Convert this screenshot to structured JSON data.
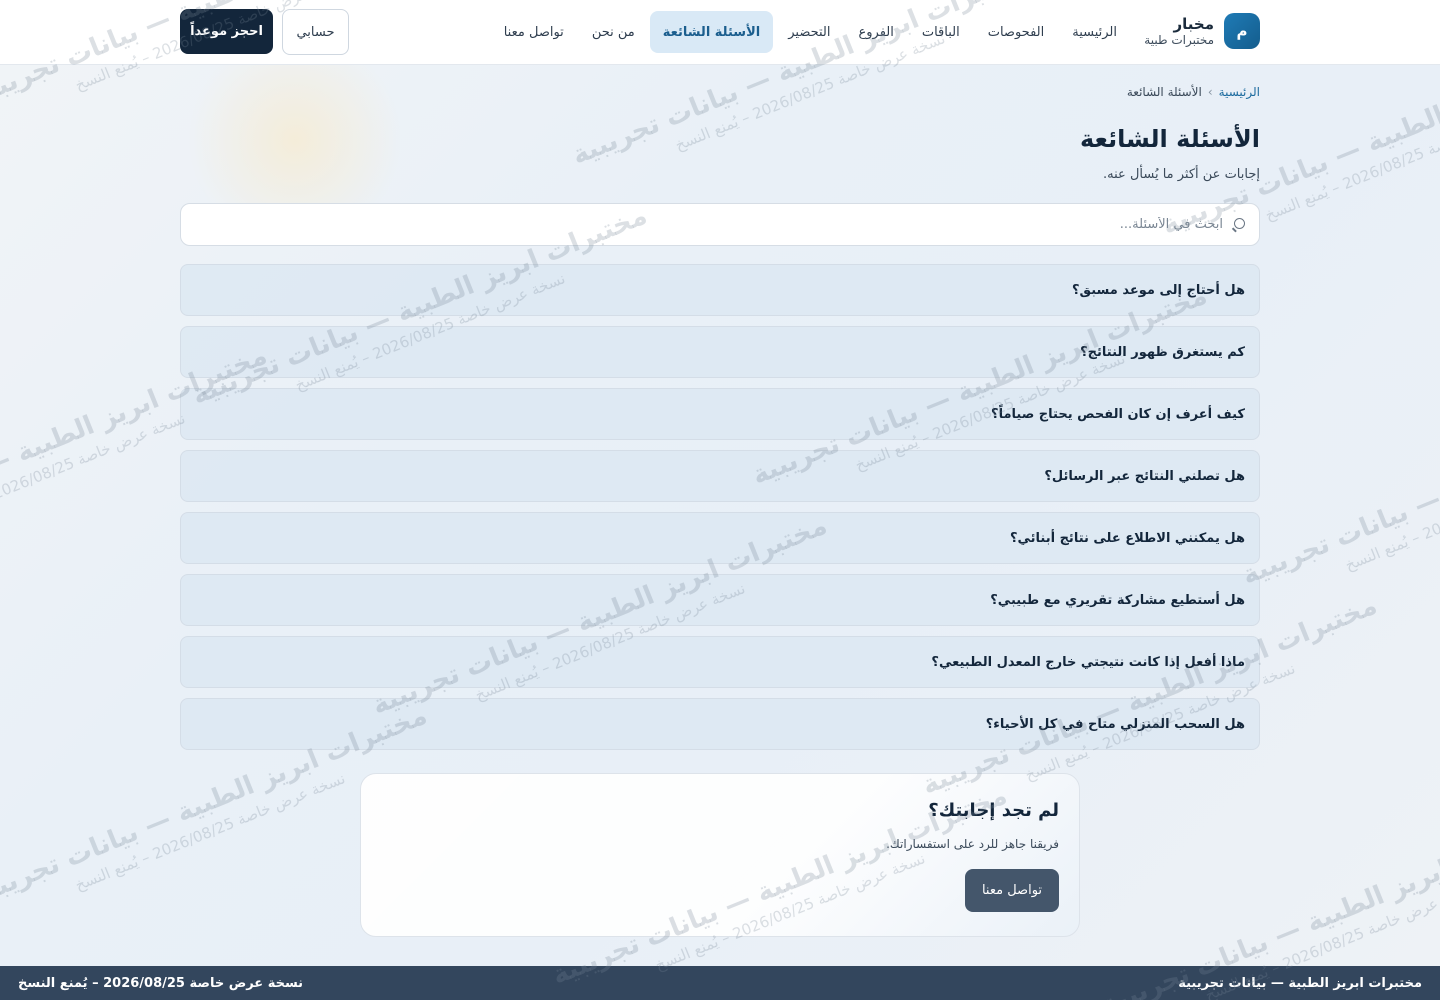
{
  "header": {
    "logo_letter": "م",
    "brand_name": "مخبار",
    "brand_sub": "مختبرات طبية",
    "nav": [
      {
        "label": "الرئيسية"
      },
      {
        "label": "الفحوصات"
      },
      {
        "label": "الباقات"
      },
      {
        "label": "الفروع"
      },
      {
        "label": "التحضير"
      },
      {
        "label": "الأسئلة الشائعة",
        "active": true
      },
      {
        "label": "من نحن"
      },
      {
        "label": "تواصل معنا"
      }
    ],
    "account_label": "حسابي",
    "book_label": "احجز موعداً"
  },
  "breadcrumb": {
    "home": "الرئيسية",
    "separator": "›",
    "current": "الأسئلة الشائعة"
  },
  "page": {
    "title": "الأسئلة الشائعة",
    "subtitle": "إجابات عن أكثر ما يُسأل عنه."
  },
  "search": {
    "placeholder": "ابحث في الأسئلة..."
  },
  "faqs": [
    "هل أحتاج إلى موعد مسبق؟",
    "كم يستغرق ظهور النتائج؟",
    "كيف أعرف إن كان الفحص يحتاج صياماً؟",
    "هل تصلني النتائج عبر الرسائل؟",
    "هل يمكنني الاطلاع على نتائج أبنائي؟",
    "هل أستطيع مشاركة تقريري مع طبيبي؟",
    "ماذا أفعل إذا كانت نتيجتي خارج المعدل الطبيعي؟",
    "هل السحب المنزلي متاح في كل الأحياء؟"
  ],
  "cta": {
    "title": "لم تجد إجابتك؟",
    "text": "فريقنا جاهز للرد على استفساراتك.",
    "button": "تواصل معنا"
  },
  "footer": {
    "left": "نسخة عرض خاصة 2026/08/25 – يُمنع النسخ",
    "right": "مختبرات ابريز الطبية — بيانات تجريبية"
  },
  "watermark": {
    "line1": "مختبرات ابريز الطبية — بيانات تجريبية",
    "line2": "نسخة عرض خاصة 2026/08/25 – يُمنع النسخ"
  },
  "colors": {
    "primary": "#1f7bb6",
    "dark": "#13263b",
    "active_bg": "#d9e9f6",
    "footer_bg": "#33465d"
  }
}
